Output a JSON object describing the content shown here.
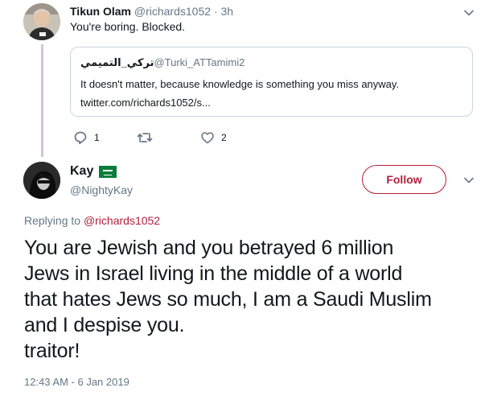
{
  "parent_tweet": {
    "author_name": "Tikun Olam",
    "author_handle": "@richards1052",
    "separator": "·",
    "time": "3h",
    "text": "You're boring. Blocked.",
    "quoted_tweet": {
      "author_name": "تركي_التميمي",
      "author_handle": "@Turki_ATTamimi2",
      "text": "It doesn't matter, because knowledge is something you miss anyway.",
      "link": "twitter.com/richards1052/s..."
    },
    "actions": {
      "reply_count": "1",
      "retweet_count": "",
      "like_count": "2"
    }
  },
  "main_tweet": {
    "author_name": "Kay",
    "author_handle": "@NightyKay",
    "follow_label": "Follow",
    "replying_prefix": "Replying to",
    "replying_to": "@richards1052",
    "text_lines": [
      "You are Jewish and you betrayed 6 million",
      "Jews in Israel living in the middle of a world",
      "that hates Jews so much, I am a Saudi Muslim",
      "and I despise you.",
      "traitor!"
    ],
    "timestamp": "12:43 AM - 6 Jan 2019"
  },
  "colors": {
    "accent": "#b41e3c",
    "muted": "#657786",
    "thread_line": "#d8bfd8",
    "border": "#ccd6dd"
  },
  "icons": {
    "reply": "reply-icon",
    "retweet": "retweet-icon",
    "like": "heart-icon",
    "more": "chevron-down-icon",
    "flag": "saudi-flag-icon"
  }
}
